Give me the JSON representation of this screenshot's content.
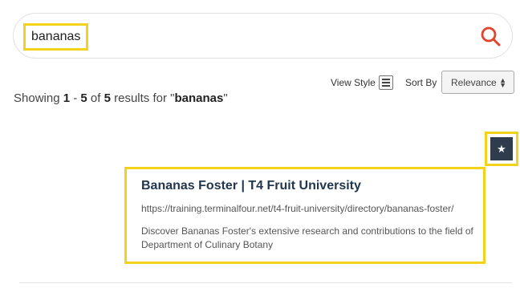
{
  "search": {
    "query": "bananas",
    "accent_color": "#e0442a",
    "highlight_color": "#f2d21b"
  },
  "summary": {
    "prefix": "Showing ",
    "range_start": "1",
    "dash": " - ",
    "range_end": "5",
    "of": " of ",
    "total": "5",
    "results_for": " results for \"",
    "term": "bananas",
    "closing_quote": "\""
  },
  "controls": {
    "view_style_label": "View Style",
    "sort_by_label": "Sort By",
    "sort_selected": "Relevance"
  },
  "favorite": {
    "icon": "star-icon",
    "glyph": "★"
  },
  "results": [
    {
      "title": "Bananas Foster | T4 Fruit University",
      "url": "https://training.terminalfour.net/t4-fruit-university/directory/bananas-foster/",
      "description": "Discover Bananas Foster's extensive research and contributions to the field of Department of Culinary Botany"
    }
  ]
}
